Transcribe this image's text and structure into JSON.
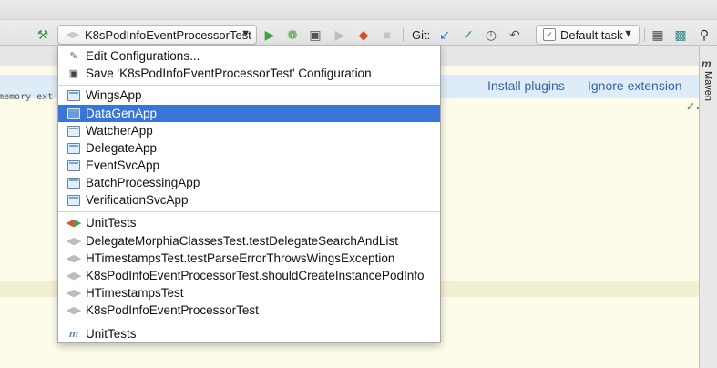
{
  "toolbar": {
    "run_config": "K8sPodInfoEventProcessorTest",
    "git_label": "Git:",
    "task": "Default task"
  },
  "notification": {
    "install_plugins": "Install plugins",
    "ignore_extension": "Ignore extension"
  },
  "editor": {
    "code_fragment": "memory ext"
  },
  "side_panel": {
    "label": "Maven",
    "m": "m"
  },
  "popup": {
    "actions": [
      {
        "label": "Edit Configurations...",
        "icon": "edit-configurations-icon"
      },
      {
        "label": "Save 'K8sPodInfoEventProcessorTest' Configuration",
        "icon": "save-icon"
      }
    ],
    "apps": [
      {
        "label": "WingsApp"
      },
      {
        "label": "DataGenApp",
        "selected": true
      },
      {
        "label": "WatcherApp"
      },
      {
        "label": "DelegateApp"
      },
      {
        "label": "EventSvcApp"
      },
      {
        "label": "BatchProcessingApp"
      },
      {
        "label": "VerificationSvcApp"
      }
    ],
    "tests": [
      {
        "label": "UnitTests"
      },
      {
        "label": "DelegateMorphiaClassesTest.testDelegateSearchAndList"
      },
      {
        "label": "HTimestampsTest.testParseErrorThrowsWingsException"
      },
      {
        "label": "K8sPodInfoEventProcessorTest.shouldCreateInstancePodInfo"
      },
      {
        "label": "HTimestampsTest"
      },
      {
        "label": "K8sPodInfoEventProcessorTest"
      }
    ],
    "maven": [
      {
        "label": "UnitTests"
      }
    ]
  },
  "colors": {
    "selection": "#3875d6",
    "link": "#3366aa",
    "editor_bg": "#fdfbe9"
  }
}
